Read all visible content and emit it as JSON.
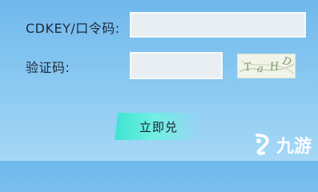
{
  "form": {
    "cdkey_label": "CDKEY/口令码:",
    "captcha_label": "验证码:",
    "cdkey_value": "",
    "captcha_value": "",
    "captcha_text": [
      "T",
      "a",
      "H",
      "D"
    ],
    "submit_label": "立即兑"
  },
  "watermark": {
    "text": "九游",
    "logo_icon": "jiuyou-logo-icon"
  },
  "colors": {
    "background": "#8ccaf2",
    "button_accent": "#3fe3d3",
    "field_bg": "#e9eef2"
  }
}
